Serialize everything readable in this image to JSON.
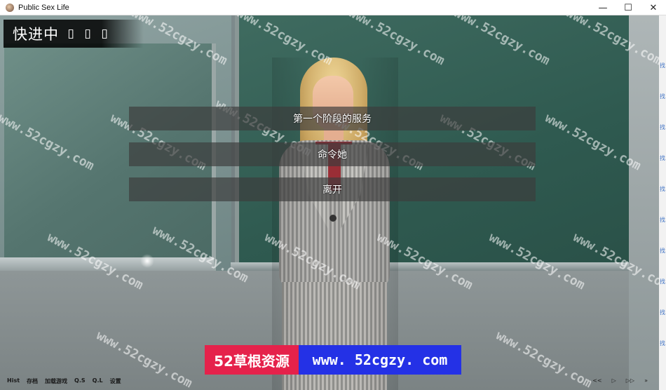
{
  "window": {
    "title": "Public Sex Life",
    "controls": {
      "minimize": "—",
      "maximize": "☐",
      "close": "✕"
    }
  },
  "hud": {
    "skip_label": "快进中",
    "skip_arrows": [
      "▯",
      "▯",
      "▯"
    ]
  },
  "choices": [
    {
      "label": "第一个阶段的服务"
    },
    {
      "label": "命令她"
    },
    {
      "label": "离开"
    }
  ],
  "quick_menu": {
    "left": [
      "Hist",
      "存档",
      "加载游戏",
      "Q.S",
      "Q.L",
      "设置"
    ],
    "right": [
      "<<",
      "▷",
      "▷▷",
      "»"
    ]
  },
  "watermark": {
    "text": "www.52cgzy.com",
    "banner_left": "52草根资源",
    "banner_right": "www. 52cgzy. com"
  },
  "right_strip_glyphs": [
    "找",
    "找",
    "找",
    "找",
    "找",
    "找",
    "找",
    "找",
    "找",
    "找"
  ]
}
